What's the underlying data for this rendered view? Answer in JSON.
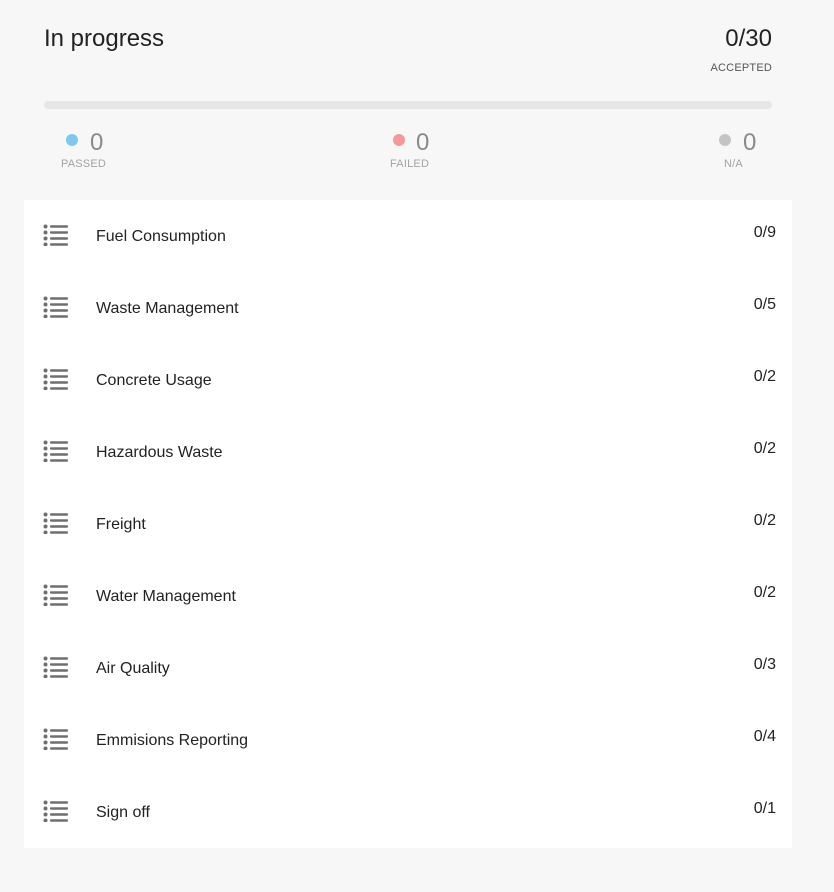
{
  "header": {
    "status": "In progress",
    "accepted_count": "0/30",
    "accepted_label": "ACCEPTED",
    "progress_fraction": 0
  },
  "stats": {
    "passed": {
      "value": "0",
      "label": "PASSED",
      "color": "#7cc8f0"
    },
    "failed": {
      "value": "0",
      "label": "FAILED",
      "color": "#f29a9a"
    },
    "na": {
      "value": "0",
      "label": "N/A",
      "color": "#c4c4c4"
    }
  },
  "sections": [
    {
      "label": "Fuel Consumption",
      "count": "0/9",
      "icon": "list-icon"
    },
    {
      "label": "Waste Management",
      "count": "0/5",
      "icon": "list-icon"
    },
    {
      "label": "Concrete Usage",
      "count": "0/2",
      "icon": "list-icon"
    },
    {
      "label": "Hazardous Waste",
      "count": "0/2",
      "icon": "list-icon"
    },
    {
      "label": "Freight",
      "count": "0/2",
      "icon": "list-icon"
    },
    {
      "label": "Water Management",
      "count": "0/2",
      "icon": "list-icon"
    },
    {
      "label": "Air Quality",
      "count": "0/3",
      "icon": "list-icon"
    },
    {
      "label": "Emmisions Reporting",
      "count": "0/4",
      "icon": "list-icon"
    },
    {
      "label": "Sign off",
      "count": "0/1",
      "icon": "list-icon"
    }
  ]
}
